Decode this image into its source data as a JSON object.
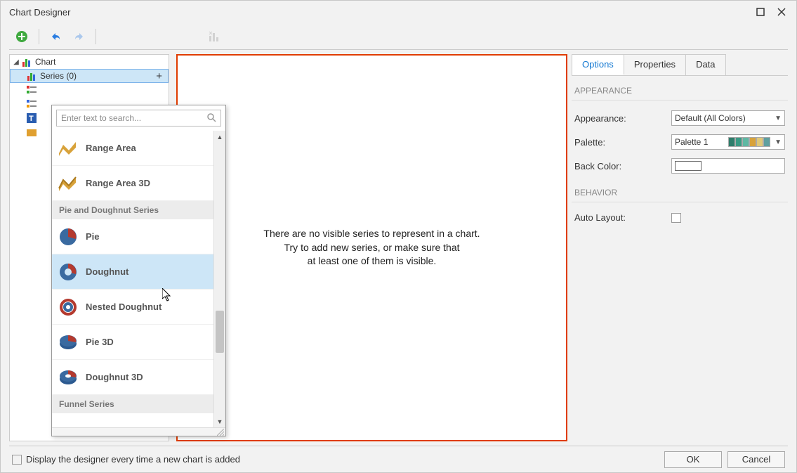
{
  "window": {
    "title": "Chart Designer"
  },
  "tree": {
    "root": "Chart",
    "series": "Series (0)"
  },
  "preview": {
    "line1": "There are no visible series to represent in a chart.",
    "line2": "Try to add new series, or make sure that",
    "line3": "at least one of them is visible."
  },
  "tabs": {
    "options": "Options",
    "properties": "Properties",
    "data": "Data"
  },
  "sections": {
    "appearance": "APPEARANCE",
    "behavior": "BEHAVIOR"
  },
  "props": {
    "appearance_label": "Appearance:",
    "appearance_value": "Default (All Colors)",
    "palette_label": "Palette:",
    "palette_value": "Palette 1",
    "back_color_label": "Back Color:",
    "auto_layout_label": "Auto Layout:"
  },
  "footer": {
    "display_label": "Display the designer every time a new chart is added",
    "ok": "OK",
    "cancel": "Cancel"
  },
  "popup": {
    "search_placeholder": "Enter text to search...",
    "group_pie": "Pie and Doughnut Series",
    "group_funnel": "Funnel Series",
    "items": {
      "range_area": "Range Area",
      "range_area_3d": "Range Area 3D",
      "pie": "Pie",
      "doughnut": "Doughnut",
      "nested_doughnut": "Nested Doughnut",
      "pie_3d": "Pie 3D",
      "doughnut_3d": "Doughnut 3D"
    }
  },
  "palette_colors": [
    "#2f7d6b",
    "#3a9a84",
    "#5fb8a3",
    "#d8a23a",
    "#e0c978",
    "#5fa0a0"
  ]
}
